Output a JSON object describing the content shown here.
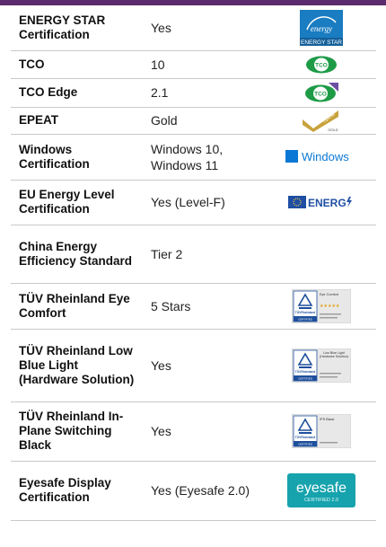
{
  "rows": [
    {
      "label": "ENERGY STAR Certification",
      "value": "Yes",
      "logo": {
        "icon": "energy-star-logo",
        "text": "ENERGY STAR"
      }
    },
    {
      "label": "TCO",
      "value": "10",
      "logo": {
        "icon": "tco-logo",
        "text": "TCO"
      }
    },
    {
      "label": "TCO Edge",
      "value": "2.1",
      "logo": {
        "icon": "tco-edge-logo",
        "text": "TCO"
      }
    },
    {
      "label": "EPEAT",
      "value": "Gold",
      "logo": {
        "icon": "epeat-gold-logo",
        "text": "epeat",
        "sub": "GOLD"
      }
    },
    {
      "label": "Windows Certification",
      "value": "Windows 10, Windows 11",
      "logo": {
        "icon": "windows-logo",
        "text": "Windows"
      }
    },
    {
      "label": "EU Energy Level Certification",
      "value": "Yes (Level-F)",
      "logo": {
        "icon": "eu-energy-logo",
        "text": "ENERG"
      }
    },
    {
      "label": "China Energy Efficiency Standard",
      "value": "Tier 2",
      "logo": null
    },
    {
      "label": "TÜV Rheinland Eye Comfort",
      "value": "5 Stars",
      "logo": {
        "icon": "tuv-eye-comfort-logo",
        "text": "Eye Comfort",
        "tuv": "TÜVRheinland",
        "cert": "CERTIFIED"
      }
    },
    {
      "label": "TÜV Rheinland Low Blue Light (Hardware Solution)",
      "value": "Yes",
      "logo": {
        "icon": "tuv-low-blue-light-logo",
        "text": "Low Blue Light (Hardware Solution)",
        "tuv": "TÜVRheinland",
        "cert": "CERTIFIED"
      }
    },
    {
      "label": "TÜV Rheinland In-Plane Switching Black",
      "value": "Yes",
      "logo": {
        "icon": "tuv-ips-black-logo",
        "text": "IPS Black",
        "tuv": "TÜVRheinland",
        "cert": "CERTIFIED"
      }
    },
    {
      "label": "Eyesafe Display Certification",
      "value": "Yes (Eyesafe 2.0)",
      "logo": {
        "icon": "eyesafe-logo",
        "text": "eyesafe",
        "sub": "CERTIFIED 2.0"
      }
    }
  ],
  "colors": {
    "header_bar": "#5b2b6e",
    "energy_star_blue": "#1a7cc1",
    "tco_green": "#1e9b47",
    "epeat_gold": "#c8a23c",
    "windows_blue": "#0a78d4",
    "eu_blue": "#1f4fa3",
    "tuv_blue": "#1e4f9c",
    "eyesafe_teal": "#16a3ad"
  }
}
